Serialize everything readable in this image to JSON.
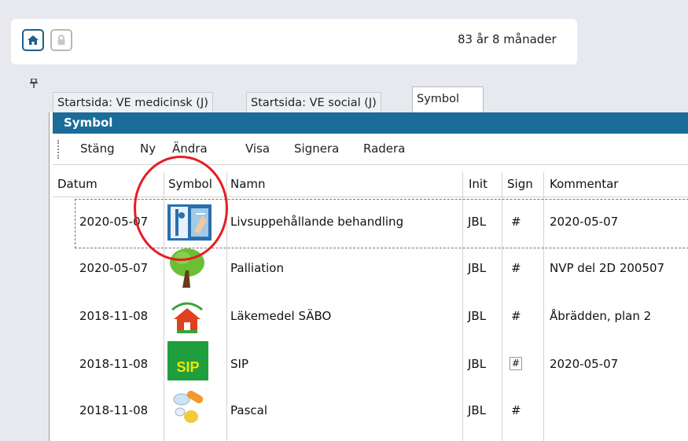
{
  "header": {
    "home_icon": "home-icon",
    "lock_icon": "lock-icon",
    "age": "83 år 8 månader"
  },
  "tabs": [
    {
      "label": "Startsida: VE medicinsk (J)"
    },
    {
      "label": "Startsida: VE social (J)"
    },
    {
      "label": "Symbol"
    }
  ],
  "panel": {
    "title": "Symbol",
    "toolbar": [
      "Stäng",
      "Ny",
      "Ändra",
      "Visa",
      "Signera",
      "Radera"
    ],
    "columns": [
      "Datum",
      "Symbol",
      "Namn",
      "Init",
      "Sign",
      "Kommentar"
    ],
    "rows": [
      {
        "date": "2020-05-07",
        "symbol": "life-support-symbol",
        "name": "Livsuppehållande behandling",
        "init": "JBL",
        "sign": "#",
        "comment": "2020-05-07"
      },
      {
        "date": "2020-05-07",
        "symbol": "tree-symbol",
        "name": "Palliation",
        "init": "JBL",
        "sign": "#",
        "comment": "NVP del 2D 200507"
      },
      {
        "date": "2018-11-08",
        "symbol": "house-symbol",
        "name": "Läkemedel SÄBO",
        "init": "JBL",
        "sign": "#",
        "comment": "Åbrädden, plan 2"
      },
      {
        "date": "2018-11-08",
        "symbol": "sip-symbol",
        "sip_text": "SIP",
        "name": "SIP",
        "init": "JBL",
        "sign": "#",
        "comment": "2020-05-07"
      },
      {
        "date": "2018-11-08",
        "symbol": "pills-symbol",
        "name": "Pascal",
        "init": "JBL",
        "sign": "#",
        "comment": ""
      }
    ]
  },
  "colors": {
    "accent": "#1b6c99",
    "highlight_circle": "#e31e24",
    "sip_bg": "#1f9e3d",
    "sip_text": "#f5e500"
  }
}
